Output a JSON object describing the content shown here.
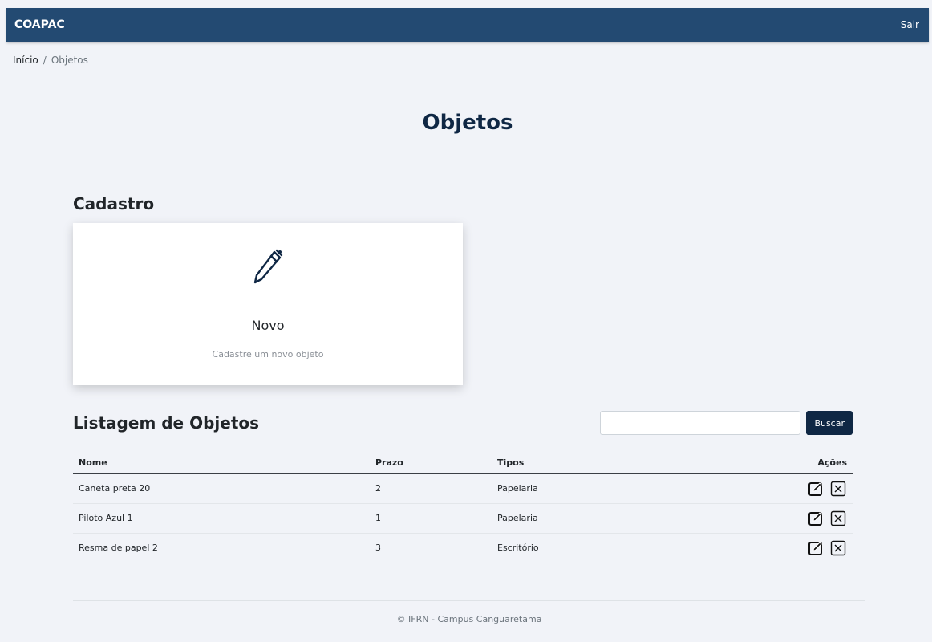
{
  "navbar": {
    "brand": "COAPAC",
    "logout": "Sair"
  },
  "breadcrumb": {
    "home": "Início",
    "separator": "/",
    "current": "Objetos"
  },
  "page": {
    "title": "Objetos"
  },
  "cadastro": {
    "section_title": "Cadastro",
    "card_title": "Novo",
    "card_description": "Cadastre um novo objeto",
    "icon": "pen-icon"
  },
  "listagem": {
    "title": "Listagem de Objetos",
    "search_placeholder": "",
    "search_value": "",
    "search_button": "Buscar",
    "columns": {
      "nome": "Nome",
      "prazo": "Prazo",
      "tipos": "Tipos",
      "acoes": "Ações"
    },
    "rows": [
      {
        "nome": "Caneta preta 20",
        "prazo": "2",
        "tipos": "Papelaria"
      },
      {
        "nome": "Piloto Azul 1",
        "prazo": "1",
        "tipos": "Papelaria"
      },
      {
        "nome": "Resma de papel 2",
        "prazo": "3",
        "tipos": "Escritório"
      }
    ]
  },
  "footer": {
    "text": "© IFRN - Campus Canguaretama"
  },
  "colors": {
    "navbar": "#234a72",
    "title": "#0f2744",
    "button": "#0f2744",
    "background": "#f1f3f8"
  }
}
